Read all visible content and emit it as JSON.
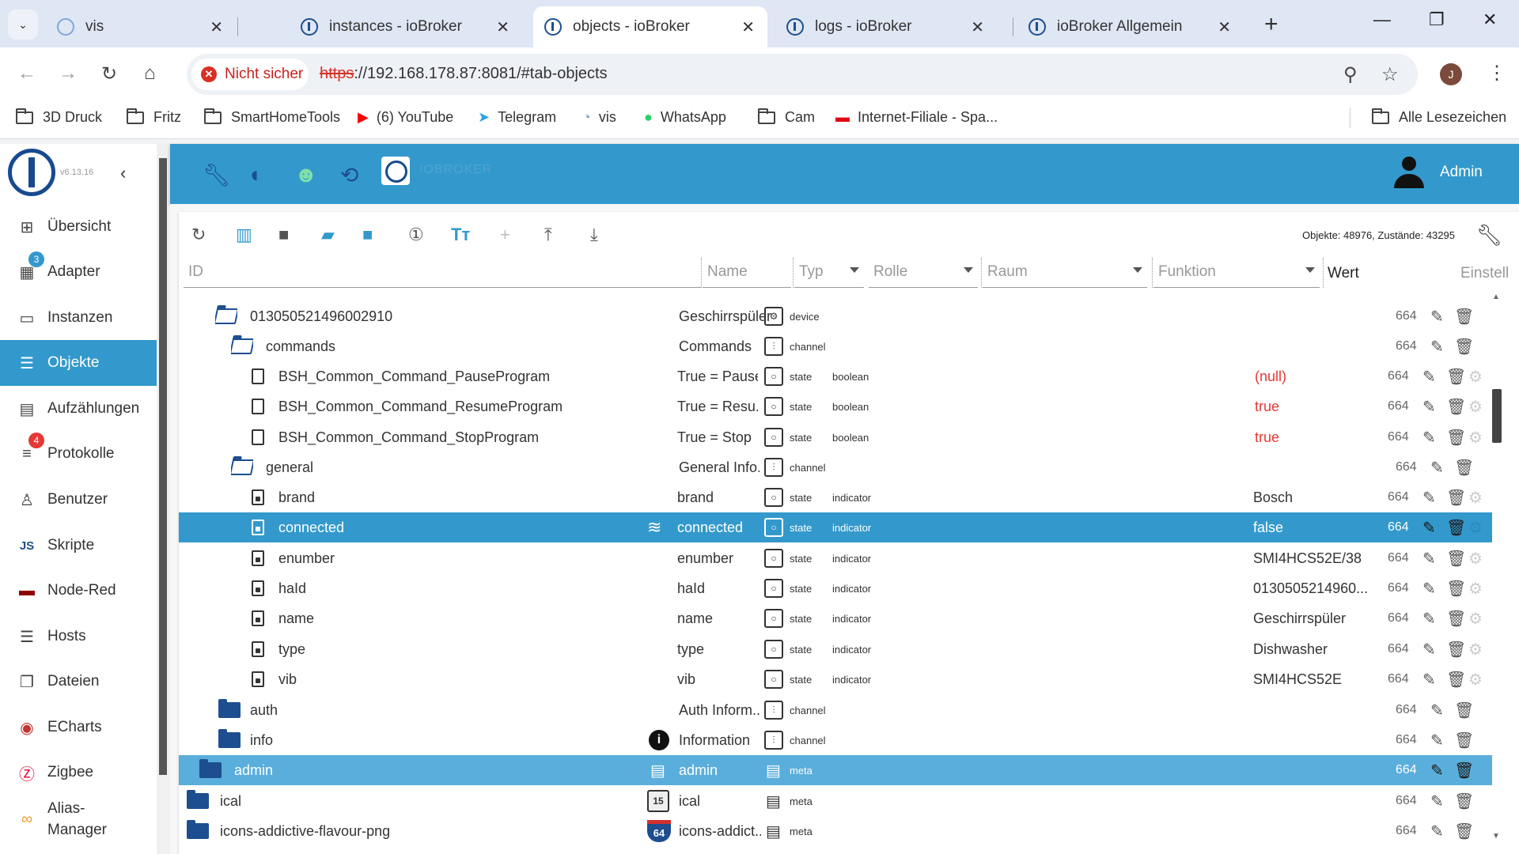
{
  "browser": {
    "tabs": [
      {
        "label": "vis",
        "icon": "vis-icon"
      },
      {
        "label": "instances - ioBroker",
        "icon": "iobroker-icon"
      },
      {
        "label": "objects - ioBroker",
        "icon": "iobroker-icon",
        "active": true
      },
      {
        "label": "logs - ioBroker",
        "icon": "iobroker-icon"
      },
      {
        "label": "ioBroker Allgemein",
        "icon": "iobroker-icon"
      }
    ],
    "security_label": "Nicht sicher",
    "url_protocol": "https",
    "url_rest": "://192.168.178.87:8081/#tab-objects",
    "profile_initial": "J",
    "bookmarks": [
      {
        "label": "3D Druck",
        "icon": "folder-icon"
      },
      {
        "label": "Fritz",
        "icon": "folder-icon"
      },
      {
        "label": "SmartHomeTools",
        "icon": "folder-icon"
      },
      {
        "label": "(6) YouTube",
        "icon": "youtube-icon"
      },
      {
        "label": "Telegram",
        "icon": "telegram-icon"
      },
      {
        "label": "vis",
        "icon": "vis-icon"
      },
      {
        "label": "WhatsApp",
        "icon": "whatsapp-icon"
      },
      {
        "label": "Cam",
        "icon": "folder-icon"
      },
      {
        "label": "Internet-Filiale - Spa...",
        "icon": "sparkasse-icon"
      }
    ],
    "all_bookmarks": "Alle Lesezeichen"
  },
  "app": {
    "version": "v6.13.16",
    "title": "IOBROKER",
    "user": "Admin",
    "accent": "#3399cc",
    "sidebar": [
      {
        "label": "Übersicht",
        "icon": "grid-icon"
      },
      {
        "label": "Adapter",
        "icon": "store-icon",
        "badge": "3"
      },
      {
        "label": "Instanzen",
        "icon": "instances-icon"
      },
      {
        "label": "Objekte",
        "icon": "list-icon",
        "active": true
      },
      {
        "label": "Aufzählungen",
        "icon": "enums-icon"
      },
      {
        "label": "Protokolle",
        "icon": "logs-icon",
        "badge": "4"
      },
      {
        "label": "Benutzer",
        "icon": "user-icon"
      },
      {
        "label": "Skripte",
        "icon": "js-icon"
      },
      {
        "label": "Node-Red",
        "icon": "nodered-icon"
      },
      {
        "label": "Hosts",
        "icon": "hosts-icon"
      },
      {
        "label": "Dateien",
        "icon": "files-icon"
      },
      {
        "label": "ECharts",
        "icon": "echarts-icon"
      },
      {
        "label": "Zigbee",
        "icon": "zigbee-icon"
      },
      {
        "label": "Alias-Manager",
        "icon": "alias-icon"
      }
    ]
  },
  "objects": {
    "stats": "Objekte: 48976, Zustände: 43295",
    "filters": {
      "id": "ID",
      "name": "Name",
      "typ": "Typ",
      "rolle": "Rolle",
      "raum": "Raum",
      "funktion": "Funktion",
      "wert": "Wert",
      "einstell": "Einstell"
    },
    "rows": [
      {
        "id": "013050521496002910",
        "name": "Geschirrspüler",
        "type": "device",
        "role": "",
        "value": "",
        "acl": "664"
      },
      {
        "id": "commands",
        "name": "Commands",
        "type": "channel",
        "role": "",
        "value": "",
        "acl": "664"
      },
      {
        "id": "BSH_Common_Command_PauseProgram",
        "name": "True = Pause",
        "type": "state",
        "role": "boolean",
        "value": "(null)",
        "acl": "664"
      },
      {
        "id": "BSH_Common_Command_ResumeProgram",
        "name": "True = Resu...",
        "type": "state",
        "role": "boolean",
        "value": "true",
        "acl": "664"
      },
      {
        "id": "BSH_Common_Command_StopProgram",
        "name": "True = Stop",
        "type": "state",
        "role": "boolean",
        "value": "true",
        "acl": "664"
      },
      {
        "id": "general",
        "name": "General Info...",
        "type": "channel",
        "role": "",
        "value": "",
        "acl": "664"
      },
      {
        "id": "brand",
        "name": "brand",
        "type": "state",
        "role": "indicator",
        "value": "Bosch",
        "acl": "664"
      },
      {
        "id": "connected",
        "name": "connected",
        "type": "state",
        "role": "indicator",
        "value": "false",
        "acl": "664"
      },
      {
        "id": "enumber",
        "name": "enumber",
        "type": "state",
        "role": "indicator",
        "value": "SMI4HCS52E/38",
        "acl": "664"
      },
      {
        "id": "haId",
        "name": "haId",
        "type": "state",
        "role": "indicator",
        "value": "0130505214960...",
        "acl": "664"
      },
      {
        "id": "name",
        "name": "name",
        "type": "state",
        "role": "indicator",
        "value": "Geschirrspüler",
        "acl": "664"
      },
      {
        "id": "type",
        "name": "type",
        "type": "state",
        "role": "indicator",
        "value": "Dishwasher",
        "acl": "664"
      },
      {
        "id": "vib",
        "name": "vib",
        "type": "state",
        "role": "indicator",
        "value": "SMI4HCS52E",
        "acl": "664"
      },
      {
        "id": "auth",
        "name": "Auth Inform...",
        "type": "channel",
        "role": "",
        "value": "",
        "acl": "664"
      },
      {
        "id": "info",
        "name": "Information",
        "type": "channel",
        "role": "",
        "value": "",
        "acl": "664"
      },
      {
        "id": "admin",
        "name": "admin",
        "type": "meta",
        "role": "",
        "value": "",
        "acl": "664"
      },
      {
        "id": "ical",
        "name": "ical",
        "type": "meta",
        "role": "",
        "value": "",
        "acl": "664"
      },
      {
        "id": "icons-addictive-flavour-png",
        "name": "icons-addict...",
        "type": "meta",
        "role": "",
        "value": "",
        "acl": "664"
      }
    ],
    "ical_icon_number": "15",
    "icons_icon_number": "64"
  }
}
